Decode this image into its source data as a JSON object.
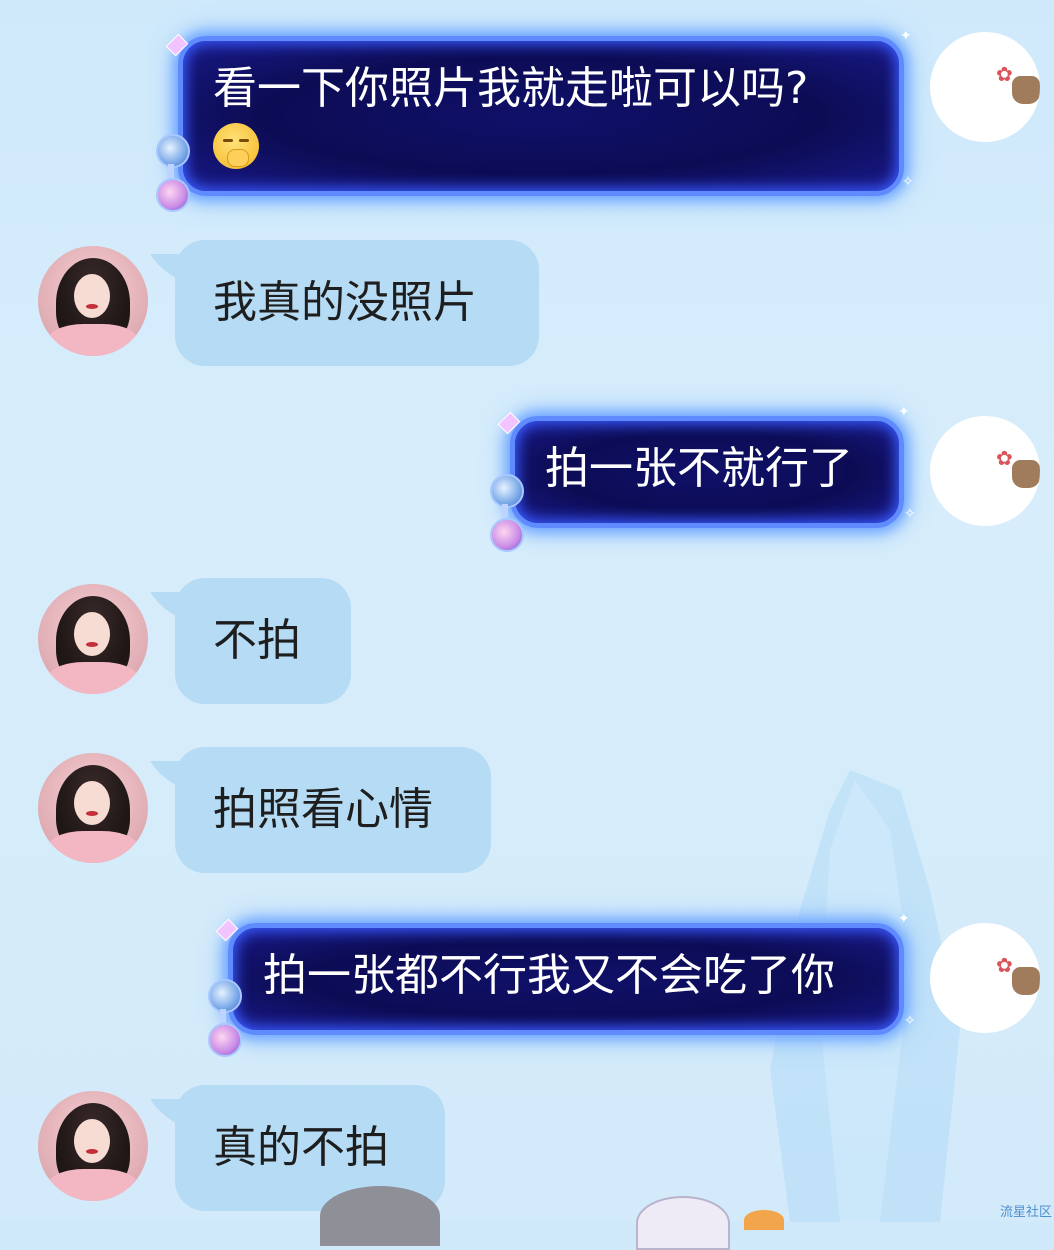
{
  "messages": [
    {
      "side": "out",
      "text": "看一下你照片我就走啦可以吗?",
      "emoji": "shushing-face-emoji"
    },
    {
      "side": "in",
      "text": "我真的没照片"
    },
    {
      "side": "out",
      "text": "拍一张不就行了"
    },
    {
      "side": "in",
      "text": "不拍"
    },
    {
      "side": "in",
      "text": "拍照看心情"
    },
    {
      "side": "out",
      "text": "拍一张都不行我又不会吃了你"
    },
    {
      "side": "in",
      "text": "真的不拍"
    }
  ],
  "watermark": "流星社区",
  "colors": {
    "background": "#d3eafa",
    "incoming_bubble": "#b5dbf5",
    "outgoing_bubble": "#0c0c55",
    "outgoing_glow": "#6ea6ff"
  }
}
